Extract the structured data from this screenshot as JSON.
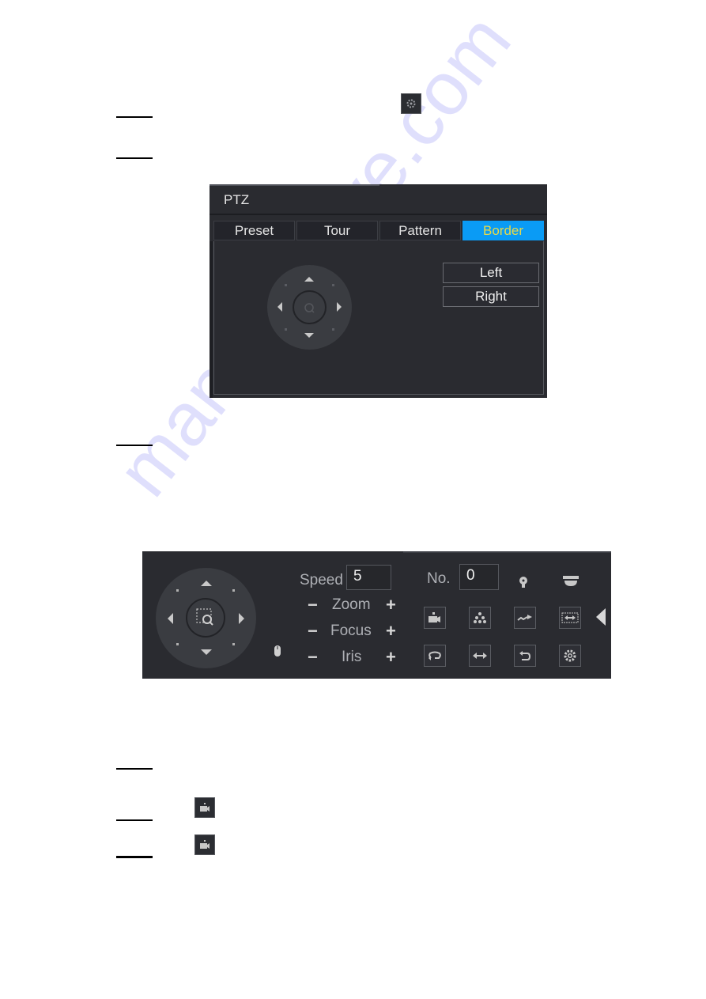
{
  "steps": {
    "inline_icons": [
      "gear-icon",
      "record-icon",
      "record-icon"
    ]
  },
  "ptz_dialog": {
    "title": "PTZ",
    "tabs": [
      {
        "label": "Preset",
        "active": false
      },
      {
        "label": "Tour",
        "active": false
      },
      {
        "label": "Pattern",
        "active": false
      },
      {
        "label": "Border",
        "active": true
      }
    ],
    "buttons": {
      "left": "Left",
      "right": "Right"
    },
    "colors": {
      "active_tab_bg": "#0a9bf5",
      "active_tab_text": "#e6d94a",
      "panel_bg": "#2a2b30"
    }
  },
  "control_bar": {
    "speed": {
      "label": "Speed",
      "value": "5"
    },
    "zoom": {
      "label": "Zoom",
      "minus": "−",
      "plus": "+"
    },
    "focus": {
      "label": "Focus",
      "minus": "−",
      "plus": "+"
    },
    "iris": {
      "label": "Iris",
      "minus": "−",
      "plus": "+"
    },
    "no": {
      "label": "No.",
      "value": "0"
    },
    "icons_row1": [
      "record-icon",
      "pattern-icon",
      "tour-icon",
      "border-icon"
    ],
    "icons_row2": [
      "rotate-icon",
      "flip-icon",
      "reset-icon",
      "settings-icon"
    ],
    "status_icons": [
      "light-icon",
      "dome-camera-icon"
    ]
  },
  "watermark": "manualshive.com"
}
